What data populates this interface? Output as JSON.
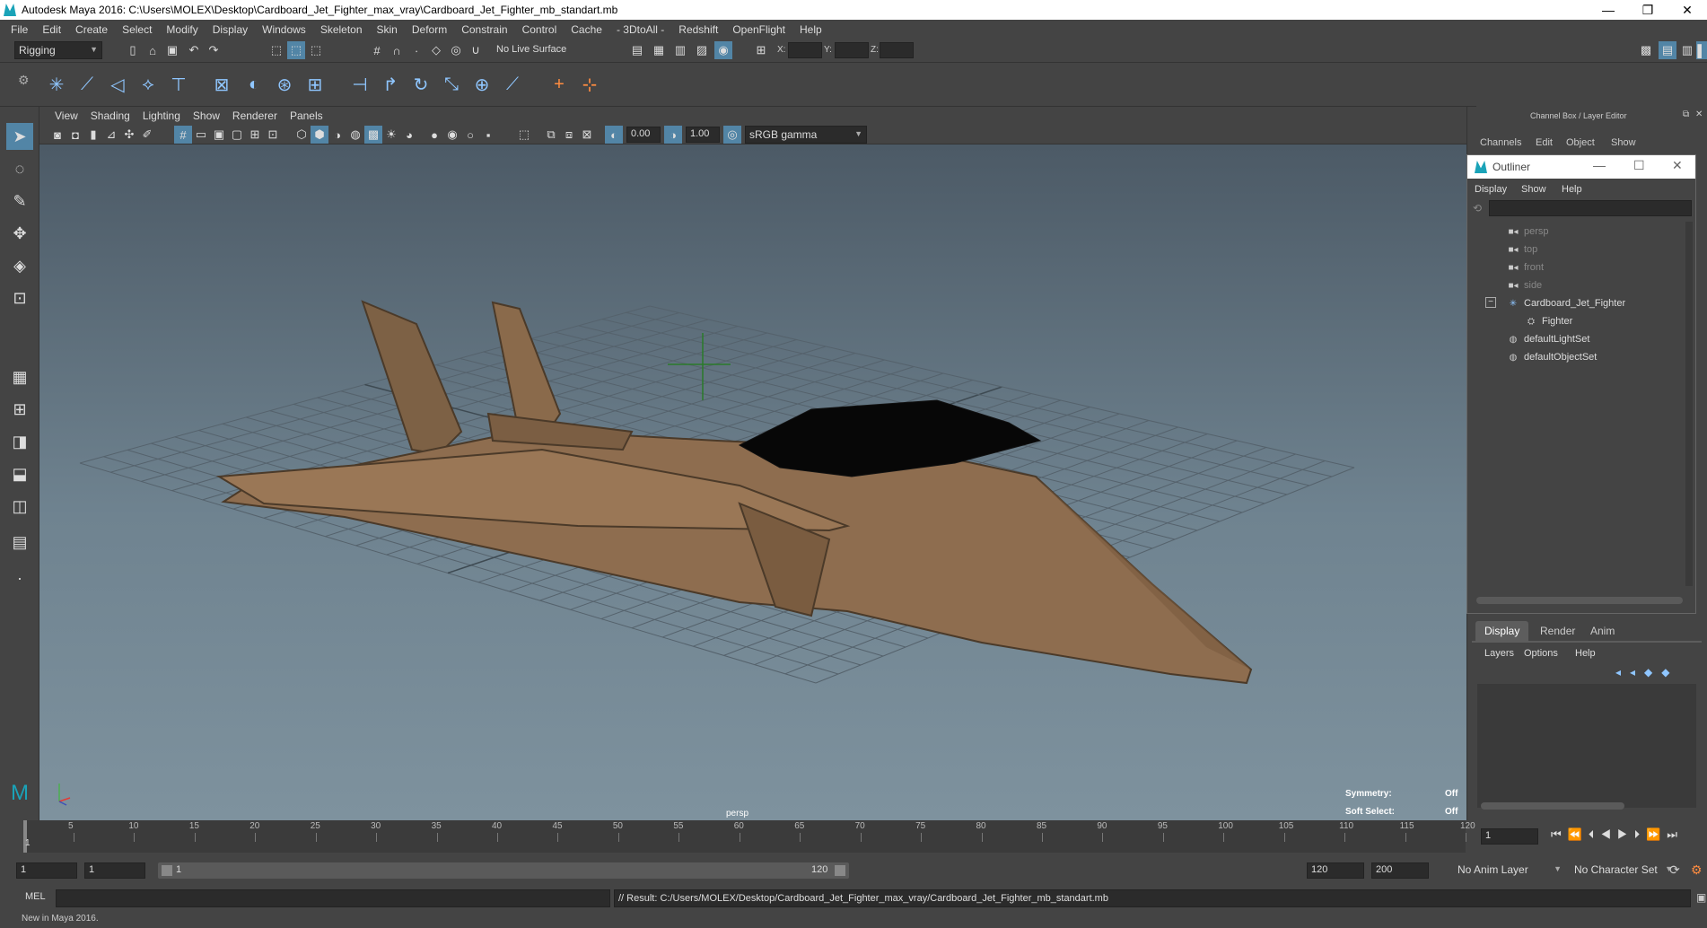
{
  "window": {
    "title": "Autodesk Maya 2016: C:\\Users\\MOLEX\\Desktop\\Cardboard_Jet_Fighter_max_vray\\Cardboard_Jet_Fighter_mb_standart.mb",
    "minimize": "—",
    "restore": "❐",
    "close": "✕"
  },
  "menubar": [
    "File",
    "Edit",
    "Create",
    "Select",
    "Modify",
    "Display",
    "Windows",
    "Skeleton",
    "Skin",
    "Deform",
    "Constrain",
    "Control",
    "Cache",
    "- 3DtoAll -",
    "Redshift",
    "OpenFlight",
    "Help"
  ],
  "statusline": {
    "menuset": "Rigging",
    "live_surface": "No Live Surface",
    "x_label": "X:",
    "y_label": "Y:",
    "z_label": "Z:"
  },
  "panel_menu": [
    "View",
    "Shading",
    "Lighting",
    "Show",
    "Renderer",
    "Panels"
  ],
  "panel_toolbar": {
    "exposure": "0.00",
    "gamma": "1.00",
    "color_space": "sRGB gamma"
  },
  "viewport": {
    "camera_label": "persp",
    "symmetry_label": "Symmetry:",
    "symmetry_value": "Off",
    "soft_select_label": "Soft Select:",
    "soft_select_value": "Off"
  },
  "channel_box": {
    "title": "Channel Box / Layer Editor",
    "menus": [
      "Channels",
      "Edit",
      "Object",
      "Show"
    ]
  },
  "outliner": {
    "title": "Outliner",
    "menus": [
      "Display",
      "Show",
      "Help"
    ],
    "items": [
      {
        "label": "persp",
        "icon": "camera-icon",
        "kind": "camera"
      },
      {
        "label": "top",
        "icon": "camera-icon",
        "kind": "camera"
      },
      {
        "label": "front",
        "icon": "camera-icon",
        "kind": "camera"
      },
      {
        "label": "side",
        "icon": "camera-icon",
        "kind": "camera"
      },
      {
        "label": "Cardboard_Jet_Fighter",
        "icon": "group-icon",
        "kind": "group"
      },
      {
        "label": "Fighter",
        "icon": "mesh-icon",
        "kind": "child"
      },
      {
        "label": "defaultLightSet",
        "icon": "set-icon",
        "kind": "set"
      },
      {
        "label": "defaultObjectSet",
        "icon": "set-icon",
        "kind": "set"
      }
    ]
  },
  "layer_editor": {
    "tabs": [
      "Display",
      "Render",
      "Anim"
    ],
    "active_tab": "Display",
    "menus": [
      "Layers",
      "Options",
      "Help"
    ]
  },
  "timeslider": {
    "ticks": [
      "1",
      "5",
      "10",
      "15",
      "20",
      "25",
      "30",
      "35",
      "40",
      "45",
      "50",
      "55",
      "60",
      "65",
      "70",
      "75",
      "80",
      "85",
      "90",
      "95",
      "100",
      "105",
      "110",
      "115",
      "120"
    ],
    "current_frame": "1",
    "current_frame_field": "1"
  },
  "range": {
    "start": "1",
    "playback_start": "1",
    "range_start_label": "1",
    "range_end_label": "120",
    "playback_end": "120",
    "end": "200",
    "anim_layer": "No Anim Layer",
    "character_set": "No Character Set"
  },
  "command": {
    "language": "MEL",
    "result": "// Result: C:/Users/MOLEX/Desktop/Cardboard_Jet_Fighter_max_vray/Cardboard_Jet_Fighter_mb_standart.mb"
  },
  "helpline": "New in Maya 2016."
}
